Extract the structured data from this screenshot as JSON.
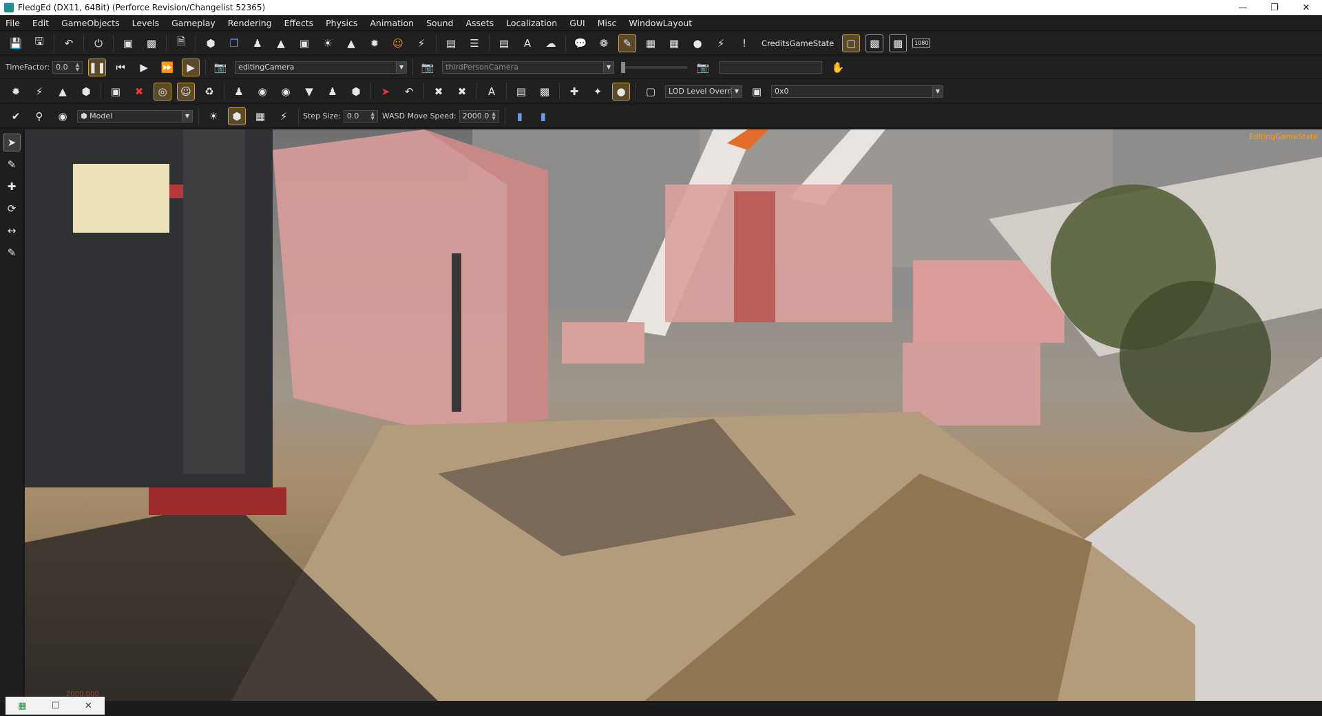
{
  "window": {
    "title": "FledgEd (DX11, 64Bit) (Perforce Revision/Changelist 52365)",
    "minimize": "—",
    "restore": "❐",
    "close": "✕"
  },
  "menu": [
    "File",
    "Edit",
    "GameObjects",
    "Levels",
    "Gameplay",
    "Rendering",
    "Effects",
    "Physics",
    "Animation",
    "Sound",
    "Assets",
    "Localization",
    "GUI",
    "Misc",
    "WindowLayout"
  ],
  "toolbar1": {
    "game_state": "CreditsGameState",
    "resolution_badge": "1080"
  },
  "toolbar2": {
    "timefactor_label": "TimeFactor:",
    "timefactor_value": "0.0",
    "camera_value": "editingCamera",
    "secondary_camera": "thirdPersonCamera"
  },
  "toolbar3": {
    "lod_override": "LOD Level Overrid",
    "resolution_value": "0x0"
  },
  "toolbar4": {
    "mode_value": "Model",
    "step_size_label": "Step Size:",
    "step_size_value": "0.0",
    "move_speed_label": "WASD Move Speed:",
    "move_speed_value": "2000.0"
  },
  "viewport": {
    "state_label": "EditingGameState",
    "coords_text": "2000.000"
  },
  "colors": {
    "accent_orange": "#ff9a1e",
    "active_border": "#c9a24a",
    "panel_bg": "#202020"
  }
}
